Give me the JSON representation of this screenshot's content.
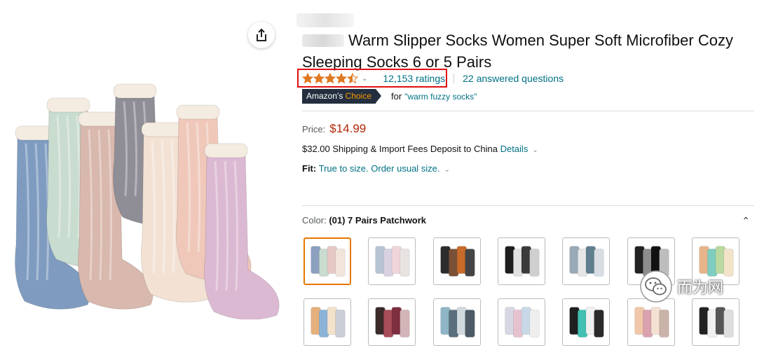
{
  "product": {
    "title": "Warm Slipper Socks Women Super Soft Microfiber Cozy Sleeping Socks 6 or 5 Pairs",
    "rating": 4.5,
    "ratings_count": "12,153 ratings",
    "answered_questions": "22 answered questions",
    "badge": {
      "prefix": "Amazon's",
      "suffix": "Choice"
    },
    "badge_for": "for",
    "badge_keyword": "\"warm fuzzy socks\"",
    "price_label": "Price:",
    "price": "$14.99",
    "shipping_text": "$32.00 Shipping & Import Fees Deposit to China",
    "shipping_link": "Details",
    "fit_label": "Fit:",
    "fit_value": "True to size. Order usual size.",
    "color_label": "Color:",
    "color_value": "(01) 7 Pairs Patchwork"
  },
  "swatches": [
    {
      "label": "7 Pairs Patchwork",
      "colors": [
        "#8aa0be",
        "#c9dccf",
        "#e6c8c4",
        "#f1e4db"
      ],
      "selected": true
    },
    {
      "label": "swatch 2",
      "colors": [
        "#b7c4d4",
        "#d8d1e2",
        "#f0d6d9",
        "#e8e3e0"
      ]
    },
    {
      "label": "swatch 3",
      "colors": [
        "#2c2c2c",
        "#7a5136",
        "#c86a2a",
        "#444444"
      ]
    },
    {
      "label": "swatch 4",
      "colors": [
        "#1e1e1e",
        "#e0e0e0",
        "#3a3a3a",
        "#cfcfcf"
      ]
    },
    {
      "label": "swatch 5",
      "colors": [
        "#9aa9b6",
        "#e6e6e6",
        "#5f7f8f",
        "#d7dde2"
      ]
    },
    {
      "label": "swatch 6",
      "colors": [
        "#222222",
        "#8d8d8d",
        "#111111",
        "#bdbdbd"
      ]
    },
    {
      "label": "swatch 7",
      "colors": [
        "#e7b58a",
        "#7fcdc0",
        "#b9d9a0",
        "#f2e3c8"
      ]
    },
    {
      "label": "swatch 8",
      "colors": [
        "#e4b07c",
        "#8bb3d8",
        "#f1e2c9",
        "#c9cdd6"
      ]
    },
    {
      "label": "swatch 9",
      "colors": [
        "#3a2a2a",
        "#a84d5a",
        "#7d2f3f",
        "#d3b4b8"
      ]
    },
    {
      "label": "swatch 10",
      "colors": [
        "#8fb5c7",
        "#5a6f7e",
        "#cfd9de",
        "#4c5b66"
      ]
    },
    {
      "label": "swatch 11",
      "colors": [
        "#d7d7e4",
        "#e6c2cf",
        "#c8d8e7",
        "#eeeeee"
      ]
    },
    {
      "label": "swatch 12",
      "colors": [
        "#1f1f1f",
        "#41c0b3",
        "#f0f0f0",
        "#2a2a2a"
      ]
    },
    {
      "label": "swatch 13",
      "colors": [
        "#f0c7a8",
        "#d9a2ae",
        "#f4e1d3",
        "#c9b2a8"
      ]
    },
    {
      "label": "swatch 14",
      "colors": [
        "#222222",
        "#f0f0f0",
        "#555555",
        "#dddddd"
      ]
    }
  ],
  "socks": [
    {
      "color": "#7f9cc0"
    },
    {
      "color": "#c9dcd0"
    },
    {
      "color": "#d9b8ad"
    },
    {
      "color": "#8f8d96"
    },
    {
      "color": "#f3e2d4"
    },
    {
      "color": "#f0c8ba"
    },
    {
      "color": "#dcb9d2"
    }
  ],
  "watermark": {
    "text": "而为网"
  },
  "colors": {
    "accent_link": "#007185",
    "price": "#b12704",
    "badge_bg": "#232f3e",
    "badge_accent": "#ff9900",
    "highlight_box": "#e10f0f",
    "star": "#de7921"
  }
}
